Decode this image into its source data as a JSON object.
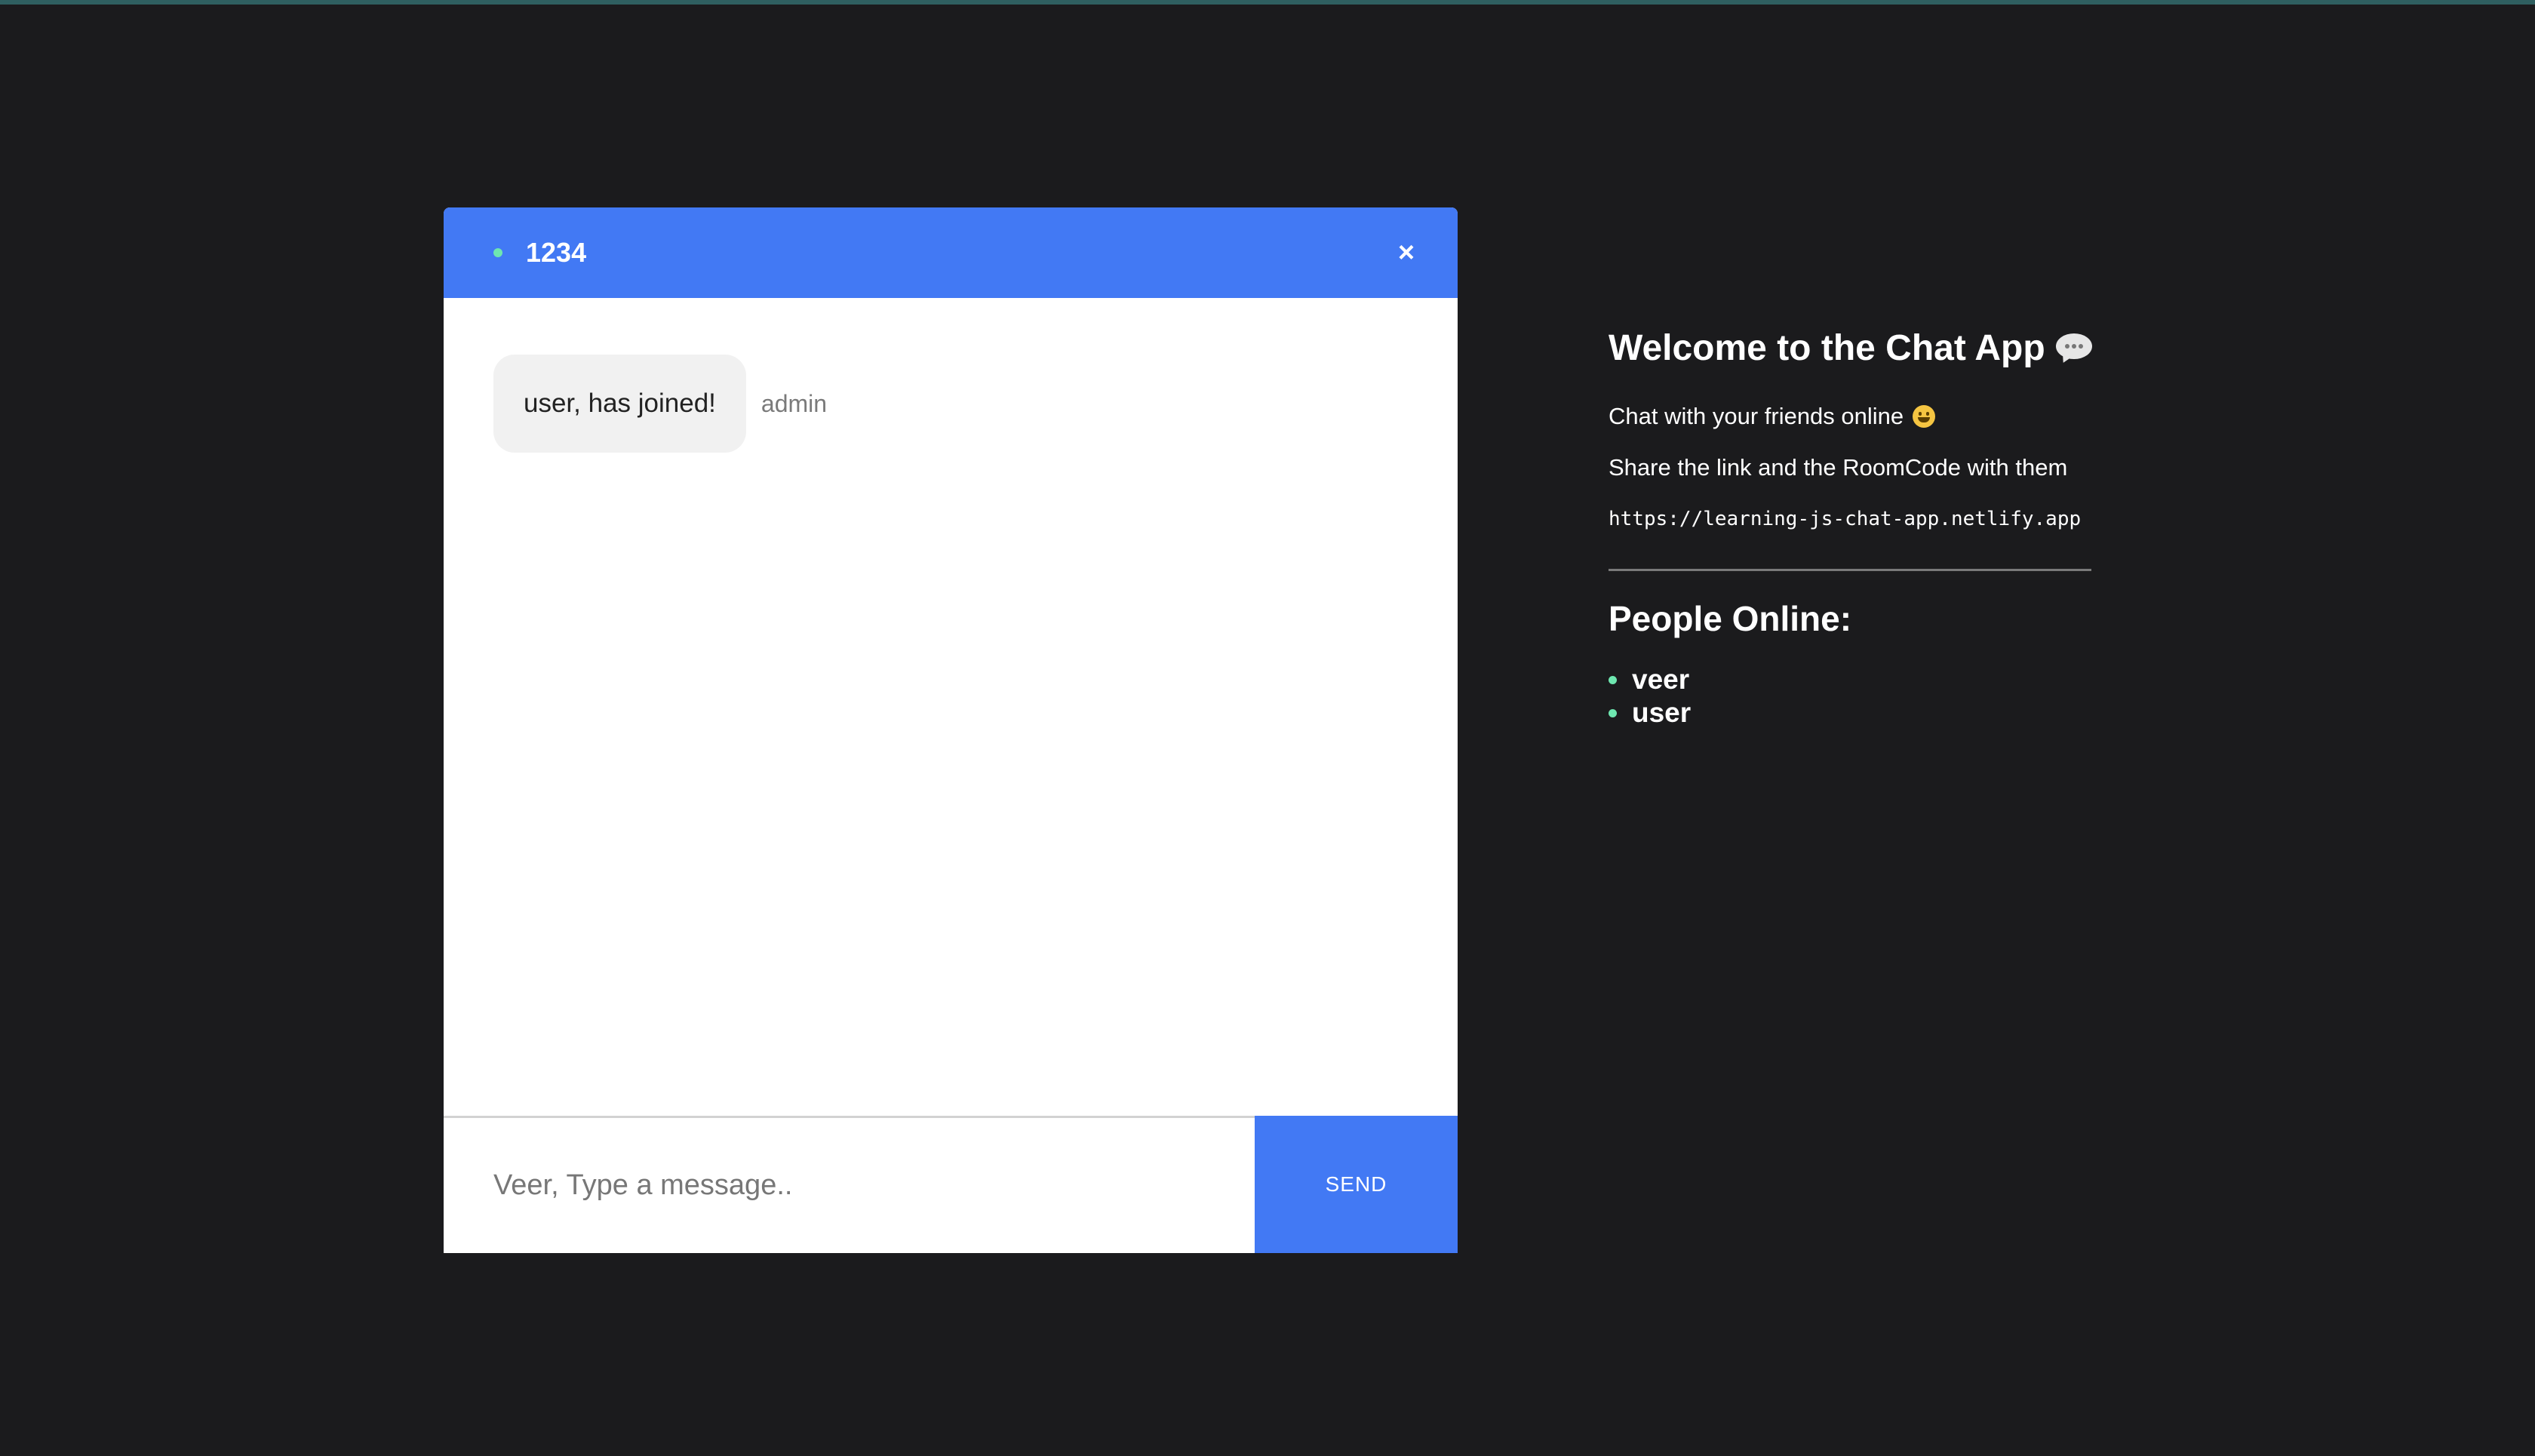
{
  "room": {
    "code": "1234",
    "close_symbol": "×"
  },
  "messages": [
    {
      "text": "user, has joined!",
      "sender": "admin"
    }
  ],
  "composer": {
    "placeholder": "Veer, Type a message..",
    "send_label": "SEND"
  },
  "info": {
    "welcome_title": "Welcome to the Chat App",
    "welcome_icon": "speech-bubble-icon",
    "tagline": "Chat with your friends online",
    "tagline_icon": "smiley-icon",
    "share_text": "Share the link and the RoomCode with them",
    "link": "https://learning-js-chat-app.netlify.app",
    "people_title": "People Online:",
    "people": [
      "veer",
      "user"
    ]
  },
  "colors": {
    "background": "#1b1b1d",
    "accent_blue": "#4279f4",
    "online_green": "#6ee7b0",
    "bubble_gray": "#f1f1f1"
  }
}
